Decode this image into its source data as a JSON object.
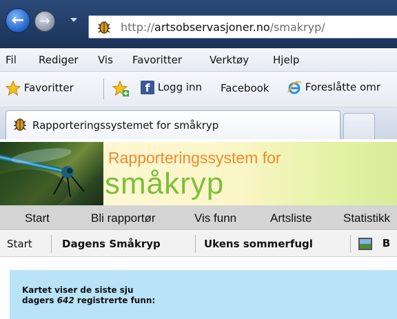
{
  "browser": {
    "url_prefix": "http://",
    "url_domain": "artsobservasjoner.no",
    "url_path": "/smakryp/",
    "back_glyph": "←",
    "forward_glyph": "→"
  },
  "menu": {
    "items": [
      "Fil",
      "Rediger",
      "Vis",
      "Favoritter",
      "Verktøy",
      "Hjelp"
    ]
  },
  "favorites_bar": {
    "favorites_label": "Favoritter",
    "items": [
      "Logg inn",
      "Facebook",
      "Foreslåtte omr"
    ]
  },
  "tab": {
    "title": "Rapporteringssystemet for småkryp"
  },
  "banner": {
    "title_line1": "Rapporteringssystem for",
    "title_line2": "småkryp",
    "colors": {
      "title1": "#f08a2a",
      "title2": "#7cbf3a"
    }
  },
  "site_nav": {
    "items": [
      "Start",
      "Bli rapportør",
      "Vis funn",
      "Artsliste",
      "Statistikk"
    ]
  },
  "sub_nav": {
    "items": [
      "Start",
      "Dagens Småkryp",
      "Ukens sommerfugl",
      "B"
    ]
  },
  "content": {
    "text_before": "Kartet viser de siste sju dagers ",
    "count": "642",
    "text_after": " registrerte funn:"
  }
}
